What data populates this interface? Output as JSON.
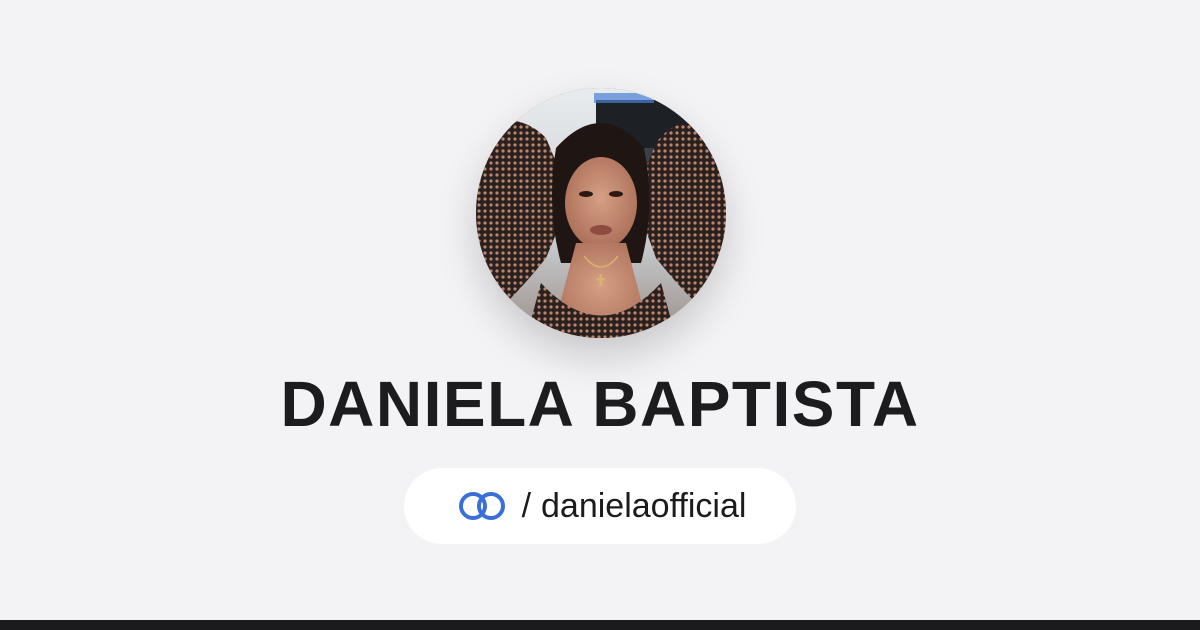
{
  "profile": {
    "name": "DANIELA BAPTISTA",
    "handle_separator": "/",
    "handle": "danielaofficial",
    "avatar_icon": "profile-photo",
    "brand_icon": "linked-rings-icon"
  },
  "colors": {
    "background": "#f3f3f5",
    "text": "#1c1c1e",
    "pill": "#ffffff",
    "brand_blue": "#3b6fd8",
    "bottom_bar": "#1b1b1d"
  }
}
